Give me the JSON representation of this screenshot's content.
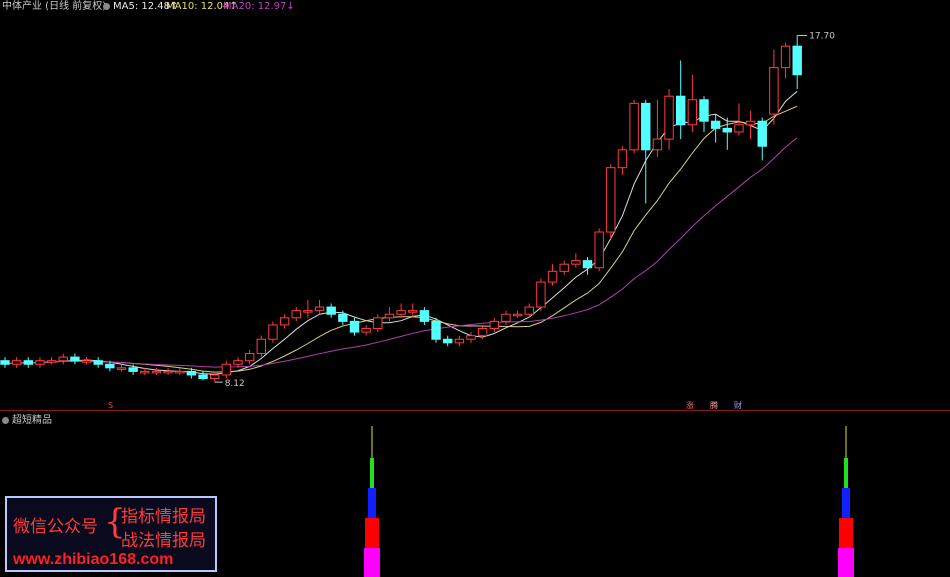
{
  "header": {
    "title": "中体产业 (日线 前复权)",
    "ma5": "MA5: 12.48↑",
    "ma10": "MA10: 12.04↑",
    "ma20": "MA20: 12.97↓"
  },
  "indicator_title": "超短精品",
  "markers": {
    "s": "S",
    "zhang": "涨",
    "teng": "腾",
    "cai": "财"
  },
  "annotations": {
    "high": "17.70",
    "low": "8.12"
  },
  "watermark": {
    "left": "微信公众号",
    "brace": "{",
    "right1": "指标情报局",
    "right2": "战法情报局",
    "url": "www.zhibiao168.com"
  },
  "chart_data": {
    "type": "candlestick",
    "title": "中体产业 (日线 前复权)",
    "ylim": [
      7.5,
      18.3
    ],
    "candles": [
      [
        8.6,
        8.5,
        8.7,
        8.4
      ],
      [
        8.5,
        8.6,
        8.7,
        8.4
      ],
      [
        8.6,
        8.5,
        8.7,
        8.4
      ],
      [
        8.5,
        8.6,
        8.7,
        8.4
      ],
      [
        8.6,
        8.6,
        8.7,
        8.5
      ],
      [
        8.6,
        8.7,
        8.8,
        8.5
      ],
      [
        8.7,
        8.6,
        8.8,
        8.5
      ],
      [
        8.6,
        8.6,
        8.7,
        8.5
      ],
      [
        8.6,
        8.5,
        8.7,
        8.4
      ],
      [
        8.5,
        8.4,
        8.6,
        8.3
      ],
      [
        8.4,
        8.4,
        8.5,
        8.3
      ],
      [
        8.4,
        8.3,
        8.5,
        8.2
      ],
      [
        8.3,
        8.3,
        8.4,
        8.2
      ],
      [
        8.3,
        8.3,
        8.4,
        8.2
      ],
      [
        8.3,
        8.3,
        8.4,
        8.2
      ],
      [
        8.3,
        8.3,
        8.4,
        8.2
      ],
      [
        8.3,
        8.2,
        8.4,
        8.1
      ],
      [
        8.2,
        8.1,
        8.3,
        8.05
      ],
      [
        8.1,
        8.2,
        8.3,
        8.0
      ],
      [
        8.2,
        8.5,
        8.6,
        8.1
      ],
      [
        8.5,
        8.6,
        8.7,
        8.4
      ],
      [
        8.6,
        8.8,
        8.9,
        8.5
      ],
      [
        8.8,
        9.2,
        9.3,
        8.7
      ],
      [
        9.2,
        9.6,
        9.7,
        9.1
      ],
      [
        9.6,
        9.8,
        9.9,
        9.5
      ],
      [
        9.8,
        10.0,
        10.1,
        9.7
      ],
      [
        10.0,
        10.0,
        10.3,
        9.8
      ],
      [
        10.0,
        10.1,
        10.3,
        9.9
      ],
      [
        10.1,
        9.9,
        10.2,
        9.8
      ],
      [
        9.9,
        9.7,
        10.0,
        9.6
      ],
      [
        9.7,
        9.4,
        9.8,
        9.3
      ],
      [
        9.4,
        9.5,
        9.6,
        9.3
      ],
      [
        9.5,
        9.8,
        9.9,
        9.4
      ],
      [
        9.8,
        9.9,
        10.1,
        9.7
      ],
      [
        9.9,
        10.0,
        10.2,
        9.8
      ],
      [
        10.0,
        10.0,
        10.2,
        9.8
      ],
      [
        10.0,
        9.7,
        10.1,
        9.6
      ],
      [
        9.7,
        9.2,
        9.8,
        9.1
      ],
      [
        9.2,
        9.1,
        9.3,
        9.0
      ],
      [
        9.1,
        9.2,
        9.3,
        9.0
      ],
      [
        9.2,
        9.3,
        9.4,
        9.1
      ],
      [
        9.3,
        9.5,
        9.6,
        9.2
      ],
      [
        9.5,
        9.7,
        9.8,
        9.4
      ],
      [
        9.7,
        9.9,
        10.0,
        9.6
      ],
      [
        9.9,
        9.9,
        10.0,
        9.8
      ],
      [
        9.9,
        10.1,
        10.2,
        9.8
      ],
      [
        10.1,
        10.8,
        10.9,
        10.0
      ],
      [
        10.8,
        11.1,
        11.3,
        10.7
      ],
      [
        11.1,
        11.3,
        11.4,
        11.0
      ],
      [
        11.3,
        11.4,
        11.6,
        11.2
      ],
      [
        11.4,
        11.2,
        11.5,
        11.0
      ],
      [
        11.2,
        12.2,
        12.3,
        11.1
      ],
      [
        12.2,
        14.0,
        14.1,
        12.0
      ],
      [
        14.0,
        14.5,
        14.6,
        13.8
      ],
      [
        14.5,
        15.8,
        15.9,
        14.4
      ],
      [
        15.8,
        14.5,
        15.9,
        13.0
      ],
      [
        14.5,
        14.8,
        15.9,
        14.3
      ],
      [
        14.8,
        16.0,
        16.2,
        14.5
      ],
      [
        16.0,
        15.2,
        17.0,
        14.8
      ],
      [
        15.2,
        15.9,
        16.6,
        15.0
      ],
      [
        15.9,
        15.3,
        16.0,
        15.0
      ],
      [
        15.3,
        15.1,
        15.5,
        14.7
      ],
      [
        15.1,
        15.0,
        15.4,
        14.5
      ],
      [
        15.0,
        15.2,
        15.8,
        14.9
      ],
      [
        15.2,
        15.3,
        15.6,
        14.8
      ],
      [
        15.3,
        14.6,
        15.4,
        14.2
      ],
      [
        15.5,
        16.8,
        17.3,
        15.2
      ],
      [
        16.8,
        17.4,
        17.5,
        16.5
      ],
      [
        17.4,
        16.6,
        17.7,
        16.2
      ]
    ]
  }
}
